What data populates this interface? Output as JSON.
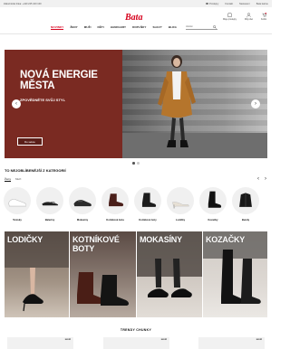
{
  "topbar": {
    "delivery": "Zákaznická linka: +420 225 100 100",
    "links": [
      "Prodejny",
      "Kontakt",
      "Nastavení",
      "Bata kartou"
    ]
  },
  "header": {
    "logo_text": "Bata",
    "icons": [
      {
        "icon": "store-icon",
        "label": "Moje prodejny"
      },
      {
        "icon": "user-icon",
        "label": "Můj účet"
      },
      {
        "icon": "cart-icon",
        "label": "Košík"
      }
    ],
    "nav": [
      "NOVINKY",
      "ŽENY",
      "MUŽI",
      "DĚTI",
      "HANDLERY",
      "DOPLŇKY",
      "SLEVY",
      "BLOG"
    ],
    "search_placeholder": "Hledat"
  },
  "hero": {
    "title": "NOVÁ ENERGIE MĚSTA",
    "subtitle": "ZPOVĚDNĚTE SVŮJ STYL",
    "cta": "Do sekce",
    "arrow_left": "‹",
    "arrow_right": "›"
  },
  "categories": {
    "title": "TO NEJOBLÍBENĚJŠÍ Z KATEGORIÍ",
    "tabs": [
      "Ženy",
      "Muži"
    ],
    "arrow_prev": "‹",
    "arrow_next": "›",
    "items": [
      {
        "label": "Tenisky"
      },
      {
        "label": "Baleríny"
      },
      {
        "label": "Mokasíny"
      },
      {
        "label": "Kotníková bota"
      },
      {
        "label": "Kotníkové boty"
      },
      {
        "label": "Lodičky"
      },
      {
        "label": "Kozačky"
      },
      {
        "label": "Bundy"
      }
    ]
  },
  "tiles": [
    {
      "label": "LODIČKY"
    },
    {
      "label": "KOTNÍKOVÉ BOTY"
    },
    {
      "label": "MOKASÍNY"
    },
    {
      "label": "KOZAČKY"
    }
  ],
  "trend": {
    "title": "TRENDY CHUNKY",
    "badges": [
      "NOVÉ",
      "NOVÉ",
      "NOVÉ"
    ]
  },
  "colors": {
    "brand_red": "#d6001c",
    "hero_bg": "#7a2a22"
  }
}
